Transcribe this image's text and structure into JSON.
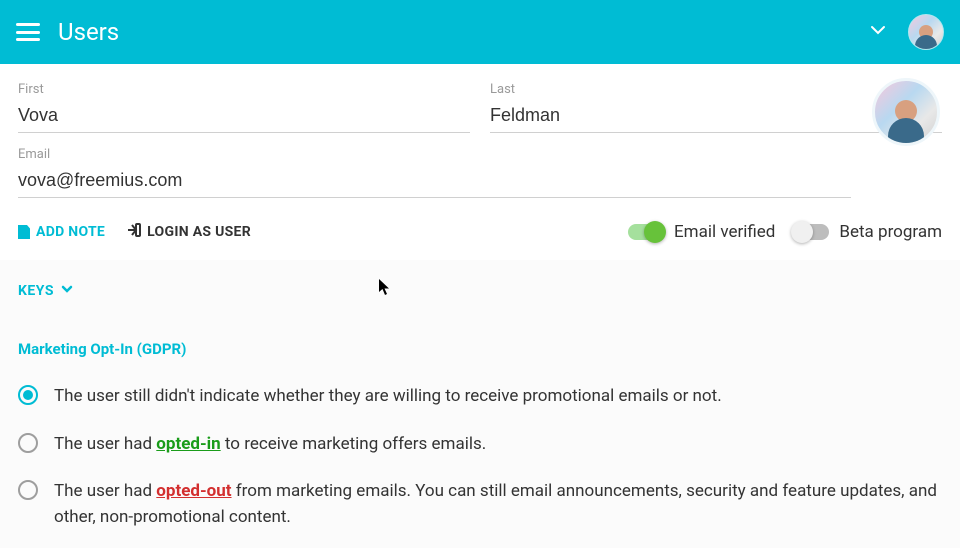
{
  "page_title": "Users",
  "form": {
    "first_label": "First",
    "first_value": "Vova",
    "last_label": "Last",
    "last_value": "Feldman",
    "email_label": "Email",
    "email_value": "vova@freemius.com"
  },
  "actions": {
    "add_note": "ADD NOTE",
    "login_as_user": "LOGIN AS USER"
  },
  "toggles": {
    "email_verified_label": "Email verified",
    "email_verified_on": true,
    "beta_program_label": "Beta program",
    "beta_program_on": false
  },
  "keys_section_label": "KEYS",
  "gdpr": {
    "title": "Marketing Opt-In (GDPR)",
    "selected": 0,
    "options": {
      "o1": "The user still didn't indicate whether they are willing to receive promotional emails or not.",
      "o2_pre": "The user had ",
      "o2_link": "opted-in",
      "o2_post": " to receive marketing offers emails.",
      "o3_pre": "The user had ",
      "o3_link": "opted-out",
      "o3_post": " from marketing emails. You can still email announcements, security and feature updates, and other, non-promotional content."
    }
  }
}
